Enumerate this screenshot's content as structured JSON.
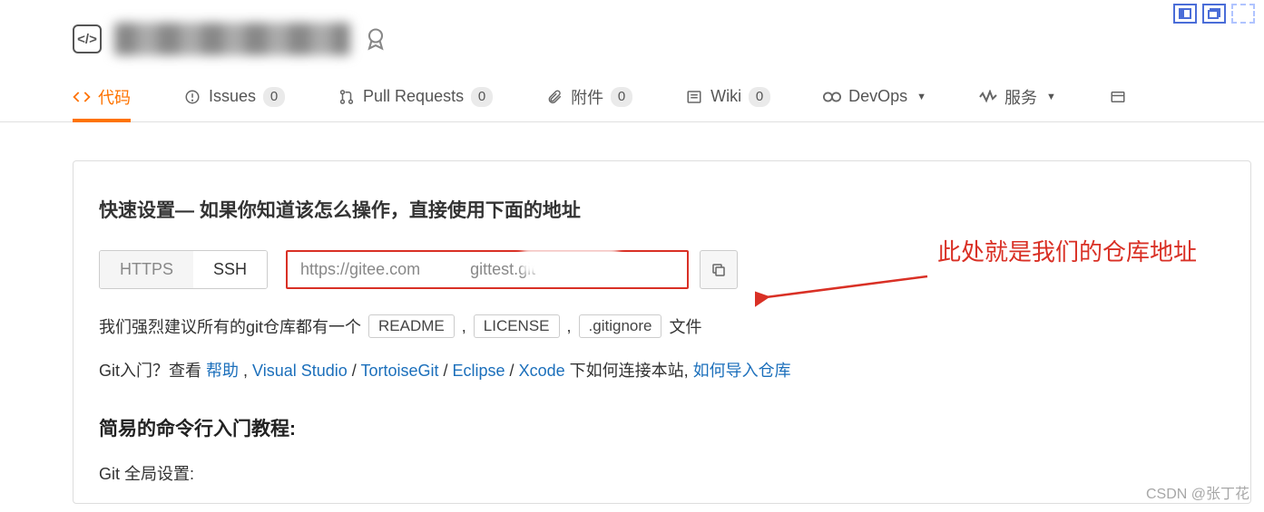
{
  "tabs": {
    "code": "代码",
    "issues": {
      "label": "Issues",
      "count": "0"
    },
    "pull_requests": {
      "label": "Pull Requests",
      "count": "0"
    },
    "attachments": {
      "label": "附件",
      "count": "0"
    },
    "wiki": {
      "label": "Wiki",
      "count": "0"
    },
    "devops": "DevOps",
    "services": "服务"
  },
  "quick_setup": {
    "title": "快速设置— 如果你知道该怎么操作，直接使用下面的地址",
    "proto_https": "HTTPS",
    "proto_ssh": "SSH",
    "url_value": "https://gitee.com           gittest.git"
  },
  "suggest": {
    "prefix": "我们强烈建议所有的git仓库都有一个",
    "readme": "README",
    "license": "LICENSE",
    "gitignore": ".gitignore",
    "suffix": "文件",
    "comma": ","
  },
  "help": {
    "prefix": "Git入门？查看 ",
    "help_link": "帮助",
    "sep1": " , ",
    "vs": "Visual Studio",
    "slash": " / ",
    "tgit": "TortoiseGit",
    "eclipse": "Eclipse",
    "xcode": "Xcode",
    "mid": " 下如何连接本站, ",
    "import": "如何导入仓库"
  },
  "cli": {
    "title": "简易的命令行入门教程:",
    "global": "Git 全局设置:"
  },
  "annotation": "此处就是我们的仓库地址",
  "watermark": "CSDN @张丁花"
}
